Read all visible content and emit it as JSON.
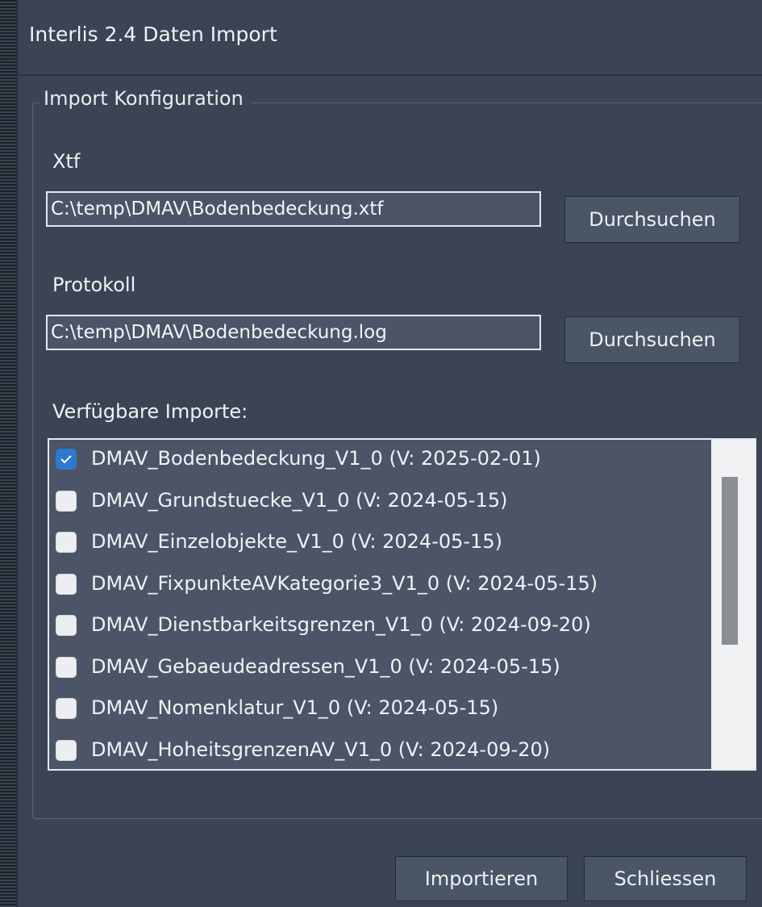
{
  "window": {
    "title": "Interlis 2.4 Daten Import"
  },
  "group": {
    "title": "Import Konfiguration"
  },
  "xtf": {
    "label": "Xtf",
    "value": "C:\\temp\\DMAV\\Bodenbedeckung.xtf",
    "browse_label": "Durchsuchen"
  },
  "protocol": {
    "label": "Protokoll",
    "value": "C:\\temp\\DMAV\\Bodenbedeckung.log",
    "browse_label": "Durchsuchen"
  },
  "imports": {
    "label": "Verfügbare Importe:",
    "items": [
      {
        "label": "DMAV_Bodenbedeckung_V1_0 (V: 2025-02-01)",
        "checked": true
      },
      {
        "label": "DMAV_Grundstuecke_V1_0 (V: 2024-05-15)",
        "checked": false
      },
      {
        "label": "DMAV_Einzelobjekte_V1_0 (V: 2024-05-15)",
        "checked": false
      },
      {
        "label": "DMAV_FixpunkteAVKategorie3_V1_0 (V: 2024-05-15)",
        "checked": false
      },
      {
        "label": "DMAV_Dienstbarkeitsgrenzen_V1_0 (V: 2024-09-20)",
        "checked": false
      },
      {
        "label": "DMAV_Gebaeudeadressen_V1_0 (V: 2024-05-15)",
        "checked": false
      },
      {
        "label": "DMAV_Nomenklatur_V1_0 (V: 2024-05-15)",
        "checked": false
      },
      {
        "label": "DMAV_HoheitsgrenzenAV_V1_0 (V: 2024-09-20)",
        "checked": false
      }
    ]
  },
  "footer": {
    "import_label": "Importieren",
    "close_label": "Schliessen"
  },
  "colors": {
    "background": "#3b4454",
    "input_background": "#4b5567",
    "checkbox_checked": "#2f78d0",
    "button_background": "#4a5566"
  }
}
